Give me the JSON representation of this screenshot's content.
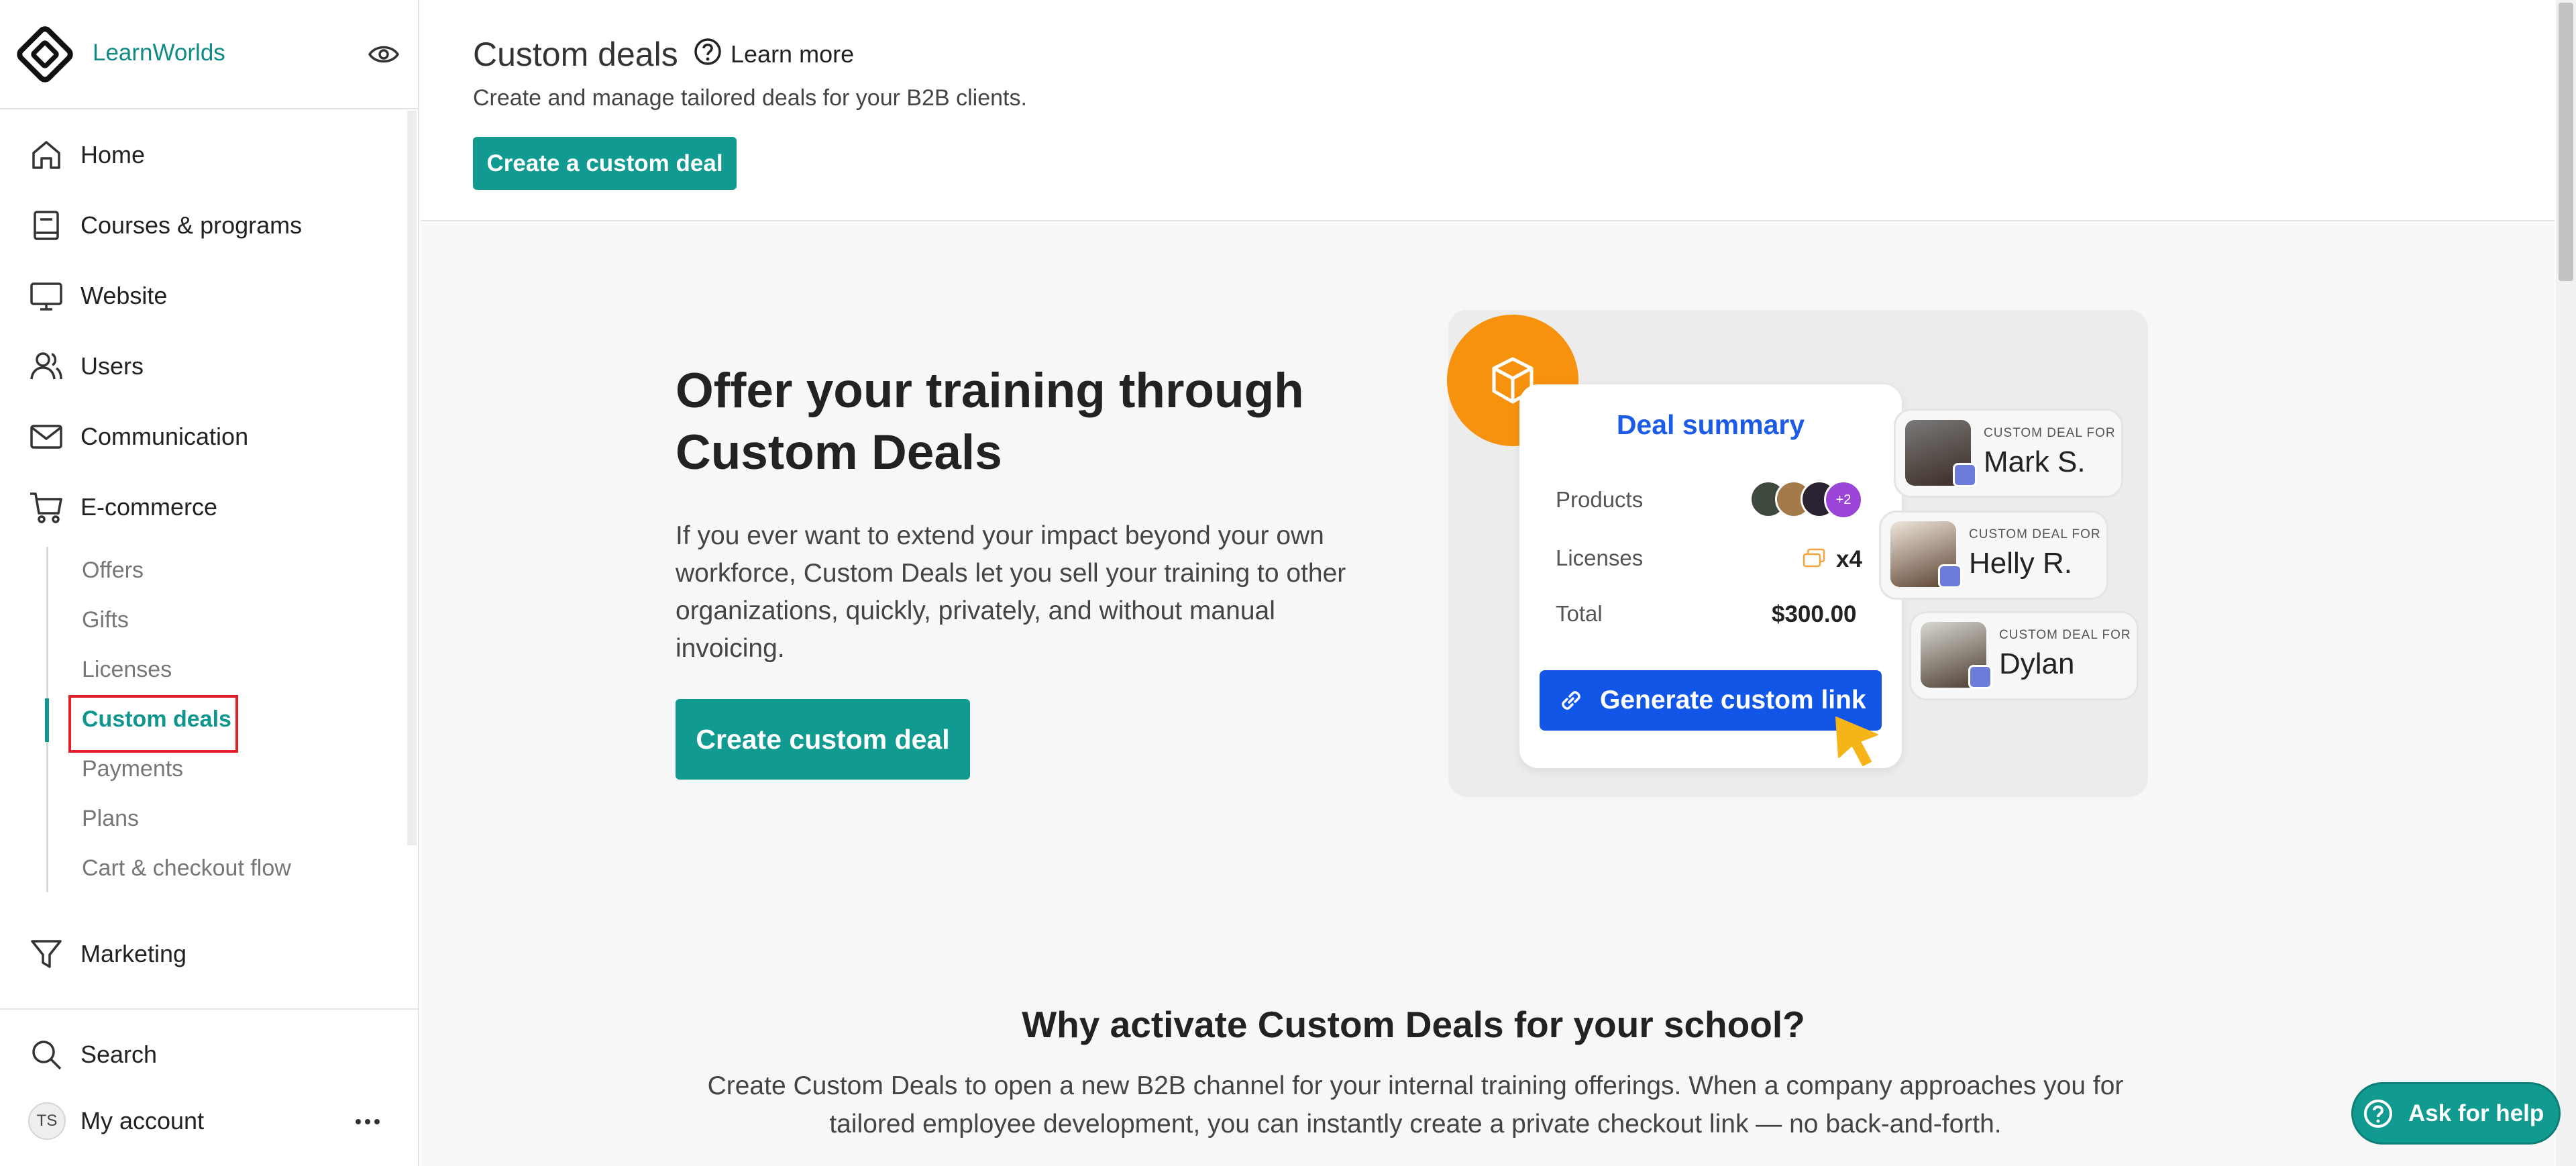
{
  "app": {
    "name": "LearnWorlds"
  },
  "sidebar": {
    "nav": [
      {
        "label": "Home",
        "icon": "home-icon"
      },
      {
        "label": "Courses & programs",
        "icon": "book-icon"
      },
      {
        "label": "Website",
        "icon": "monitor-icon"
      },
      {
        "label": "Users",
        "icon": "users-icon"
      },
      {
        "label": "Communication",
        "icon": "mail-icon"
      },
      {
        "label": "E-commerce",
        "icon": "cart-icon"
      }
    ],
    "ecommerce_sub": [
      "Offers",
      "Gifts",
      "Licenses",
      "Custom deals",
      "Payments",
      "Plans",
      "Cart & checkout flow"
    ],
    "active_sub": "Custom deals",
    "marketing": {
      "label": "Marketing",
      "icon": "filter-icon"
    },
    "search_label": "Search",
    "account": {
      "initials": "TS",
      "label": "My account"
    }
  },
  "header": {
    "title": "Custom deals",
    "learn_more": "Learn more",
    "subtitle": "Create and manage tailored deals for your B2B clients.",
    "create_button": "Create a custom deal"
  },
  "hero": {
    "title_line1": "Offer your training through",
    "title_line2": "Custom Deals",
    "text": "If you ever want to extend your impact beyond your own workforce, Custom Deals let you sell your training to other organizations, quickly, privately, and without manual invoicing.",
    "button": "Create custom deal"
  },
  "illustration": {
    "deal_summary_title": "Deal summary",
    "products_label": "Products",
    "products_more": "+2",
    "licenses_label": "Licenses",
    "licenses_value": "x4",
    "total_label": "Total",
    "total_value": "$300.00",
    "generate_button": "Generate custom link",
    "contacts_caption": "CUSTOM DEAL FOR",
    "contacts": [
      "Mark S.",
      "Helly R.",
      "Dylan"
    ]
  },
  "why": {
    "title": "Why activate Custom Deals for your school?",
    "text": "Create Custom Deals to open a new B2B channel for your internal training offerings. When a company approaches you for tailored employee development, you can instantly create a private checkout link — no back-and-forth."
  },
  "help_button": "Ask for help",
  "colors": {
    "accent": "#119a8f",
    "brand": "#0f8a84",
    "link_blue": "#1256e8",
    "orange": "#f7920f",
    "highlight": "#e0212b"
  }
}
